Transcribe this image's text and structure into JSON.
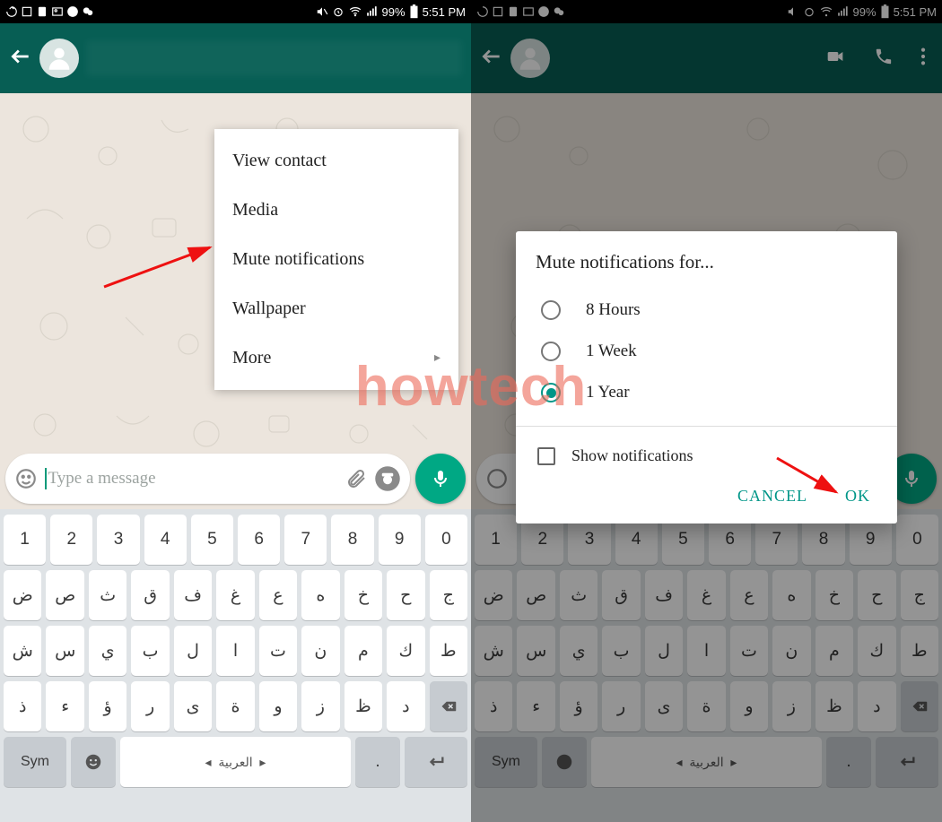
{
  "statusbar": {
    "battery": "99%",
    "time": "5:51 PM"
  },
  "header": {
    "contact_blurred": true
  },
  "menu": {
    "items": [
      {
        "label": "View contact"
      },
      {
        "label": "Media"
      },
      {
        "label": "Mute notifications"
      },
      {
        "label": "Wallpaper"
      },
      {
        "label": "More",
        "has_submenu": true
      }
    ]
  },
  "input": {
    "placeholder": "Type a message"
  },
  "keyboard": {
    "row1": [
      "1",
      "2",
      "3",
      "4",
      "5",
      "6",
      "7",
      "8",
      "9",
      "0"
    ],
    "row2": [
      "ض",
      "ص",
      "ث",
      "ق",
      "ف",
      "غ",
      "ع",
      "ه",
      "خ",
      "ح",
      "ج"
    ],
    "row3": [
      "ش",
      "س",
      "ي",
      "ب",
      "ل",
      "ا",
      "ت",
      "ن",
      "م",
      "ك",
      "ط"
    ],
    "row4_inner": [
      "ذ",
      "ء",
      "ؤ",
      "ر",
      "ى",
      "ة",
      "و",
      "ز",
      "ظ",
      "د"
    ],
    "sym": "Sym",
    "space": "العربية",
    "dot": "."
  },
  "dialog": {
    "title": "Mute notifications for...",
    "options": [
      {
        "label": "8 Hours",
        "selected": false
      },
      {
        "label": "1 Week",
        "selected": false
      },
      {
        "label": "1 Year",
        "selected": true
      }
    ],
    "check_label": "Show notifications",
    "cancel": "CANCEL",
    "ok": "OK"
  },
  "watermark": "howtech"
}
